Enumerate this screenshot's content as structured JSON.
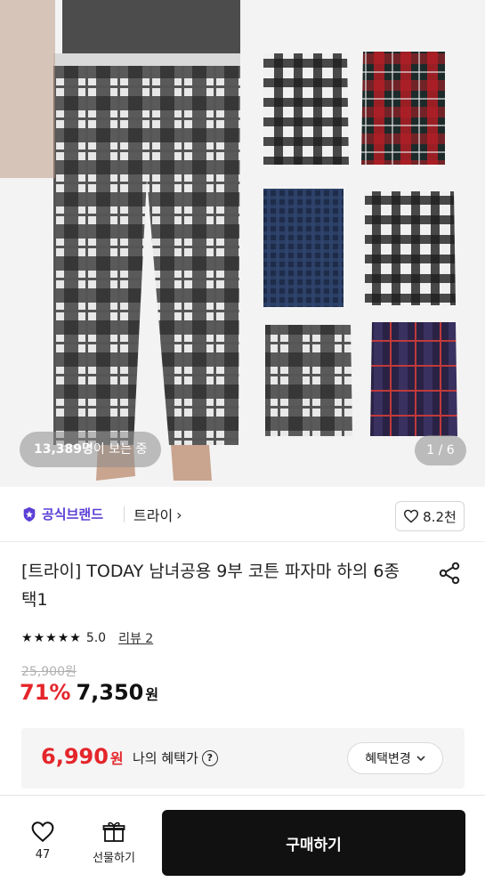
{
  "hero": {
    "viewers_count": "13,389명",
    "viewers_suffix": "이 보는 중",
    "page_indicator": "1 / 6"
  },
  "brand": {
    "official_label": "공식브랜드",
    "store_name": "트라이",
    "store_chevron": "›",
    "like_count": "8.2천"
  },
  "product": {
    "title": "[트라이] TODAY 남녀공용 9부 코튼 파자마 하의 6종 택1",
    "rating_value": "5.0",
    "review_label": "리뷰 2",
    "original_price": "25,900원",
    "discount_rate": "71%",
    "sale_price": "7,350",
    "won": "원"
  },
  "benefit": {
    "price": "6,990",
    "won": "원",
    "label": "나의 혜택가",
    "help": "?",
    "change_button": "혜택변경"
  },
  "bottom_bar": {
    "wish_count": "47",
    "gift_label": "선물하기",
    "buy_label": "구매하기"
  },
  "colors": {
    "brand_purple": "#5b3fd6",
    "discount_red": "#e4262b",
    "buy_button": "#111111"
  }
}
